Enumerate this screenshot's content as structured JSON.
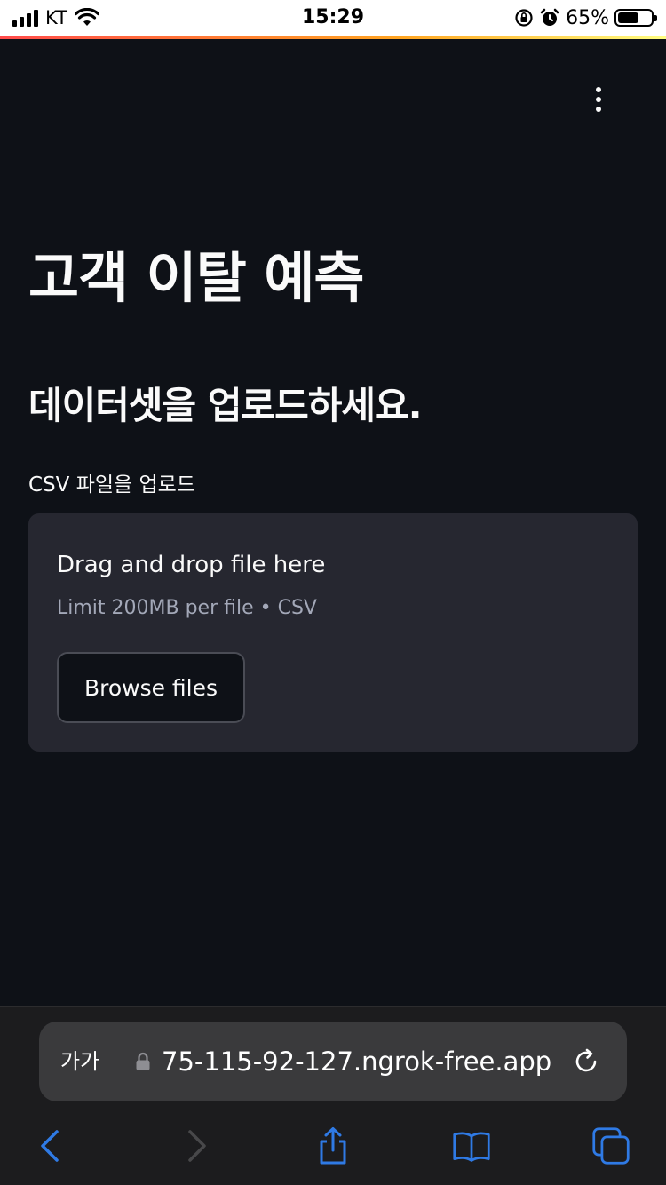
{
  "status_bar": {
    "carrier": "KT",
    "time": "15:29",
    "battery_percent": "65%",
    "battery_level": 0.65
  },
  "page": {
    "title": "고객 이탈 예측",
    "subtitle": "데이터셋을 업로드하세요."
  },
  "uploader": {
    "label": "CSV 파일을 업로드",
    "drop_text": "Drag and drop file here",
    "limit_text": "Limit 200MB per file • CSV",
    "browse_label": "Browse files"
  },
  "browser": {
    "aa_label": "가가",
    "url": "75-115-92-127.ngrok-free.app"
  },
  "colors": {
    "background": "#0e1117",
    "dropzone": "#262730",
    "accent": "#2f7ae5"
  }
}
